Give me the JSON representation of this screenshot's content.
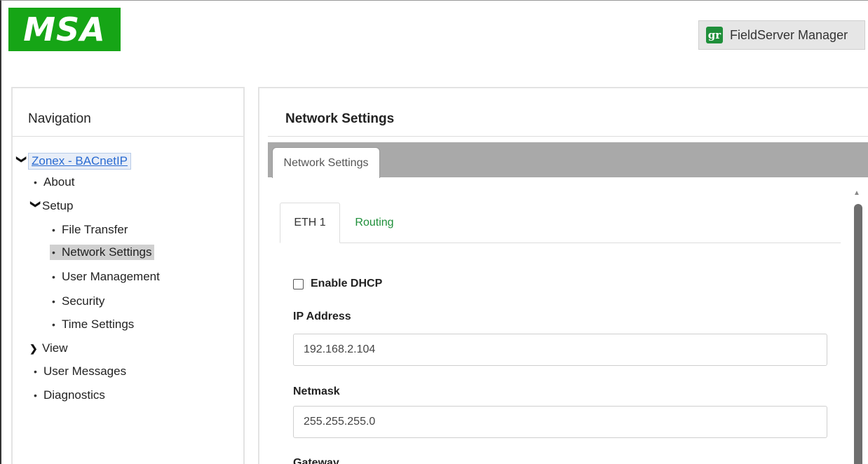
{
  "header": {
    "logo_text": "MSA",
    "fieldserver_button": {
      "icon_text": "gr",
      "label": "FieldServer Manager"
    }
  },
  "navigation": {
    "title": "Navigation",
    "root": "Zonex - BACnetIP",
    "items": [
      {
        "label": "About",
        "level": 1,
        "type": "leaf"
      },
      {
        "label": "Setup",
        "level": 1,
        "type": "expanded"
      },
      {
        "label": "File Transfer",
        "level": 2,
        "type": "leaf"
      },
      {
        "label": "Network Settings",
        "level": 2,
        "type": "leaf",
        "selected": true
      },
      {
        "label": "User Management",
        "level": 2,
        "type": "leaf"
      },
      {
        "label": "Security",
        "level": 2,
        "type": "leaf"
      },
      {
        "label": "Time Settings",
        "level": 2,
        "type": "leaf"
      },
      {
        "label": "View",
        "level": 1,
        "type": "collapsed"
      },
      {
        "label": "User Messages",
        "level": 1,
        "type": "leaf"
      },
      {
        "label": "Diagnostics",
        "level": 1,
        "type": "leaf"
      }
    ]
  },
  "main": {
    "title": "Network Settings",
    "outer_tab": "Network Settings",
    "inner_tabs": [
      {
        "label": "ETH 1",
        "active": true
      },
      {
        "label": "Routing",
        "active": false
      }
    ],
    "enable_dhcp": {
      "label": "Enable DHCP",
      "checked": false
    },
    "fields": [
      {
        "label": "IP Address",
        "value": "192.168.2.104"
      },
      {
        "label": "Netmask",
        "value": "255.255.255.0"
      },
      {
        "label": "Gateway",
        "value": ""
      }
    ]
  },
  "colors": {
    "brand_green": "#16a516",
    "link_green": "#1f8f3a",
    "nav_link_blue": "#2a6bd1",
    "tabbar_gray": "#a9a9a9"
  }
}
